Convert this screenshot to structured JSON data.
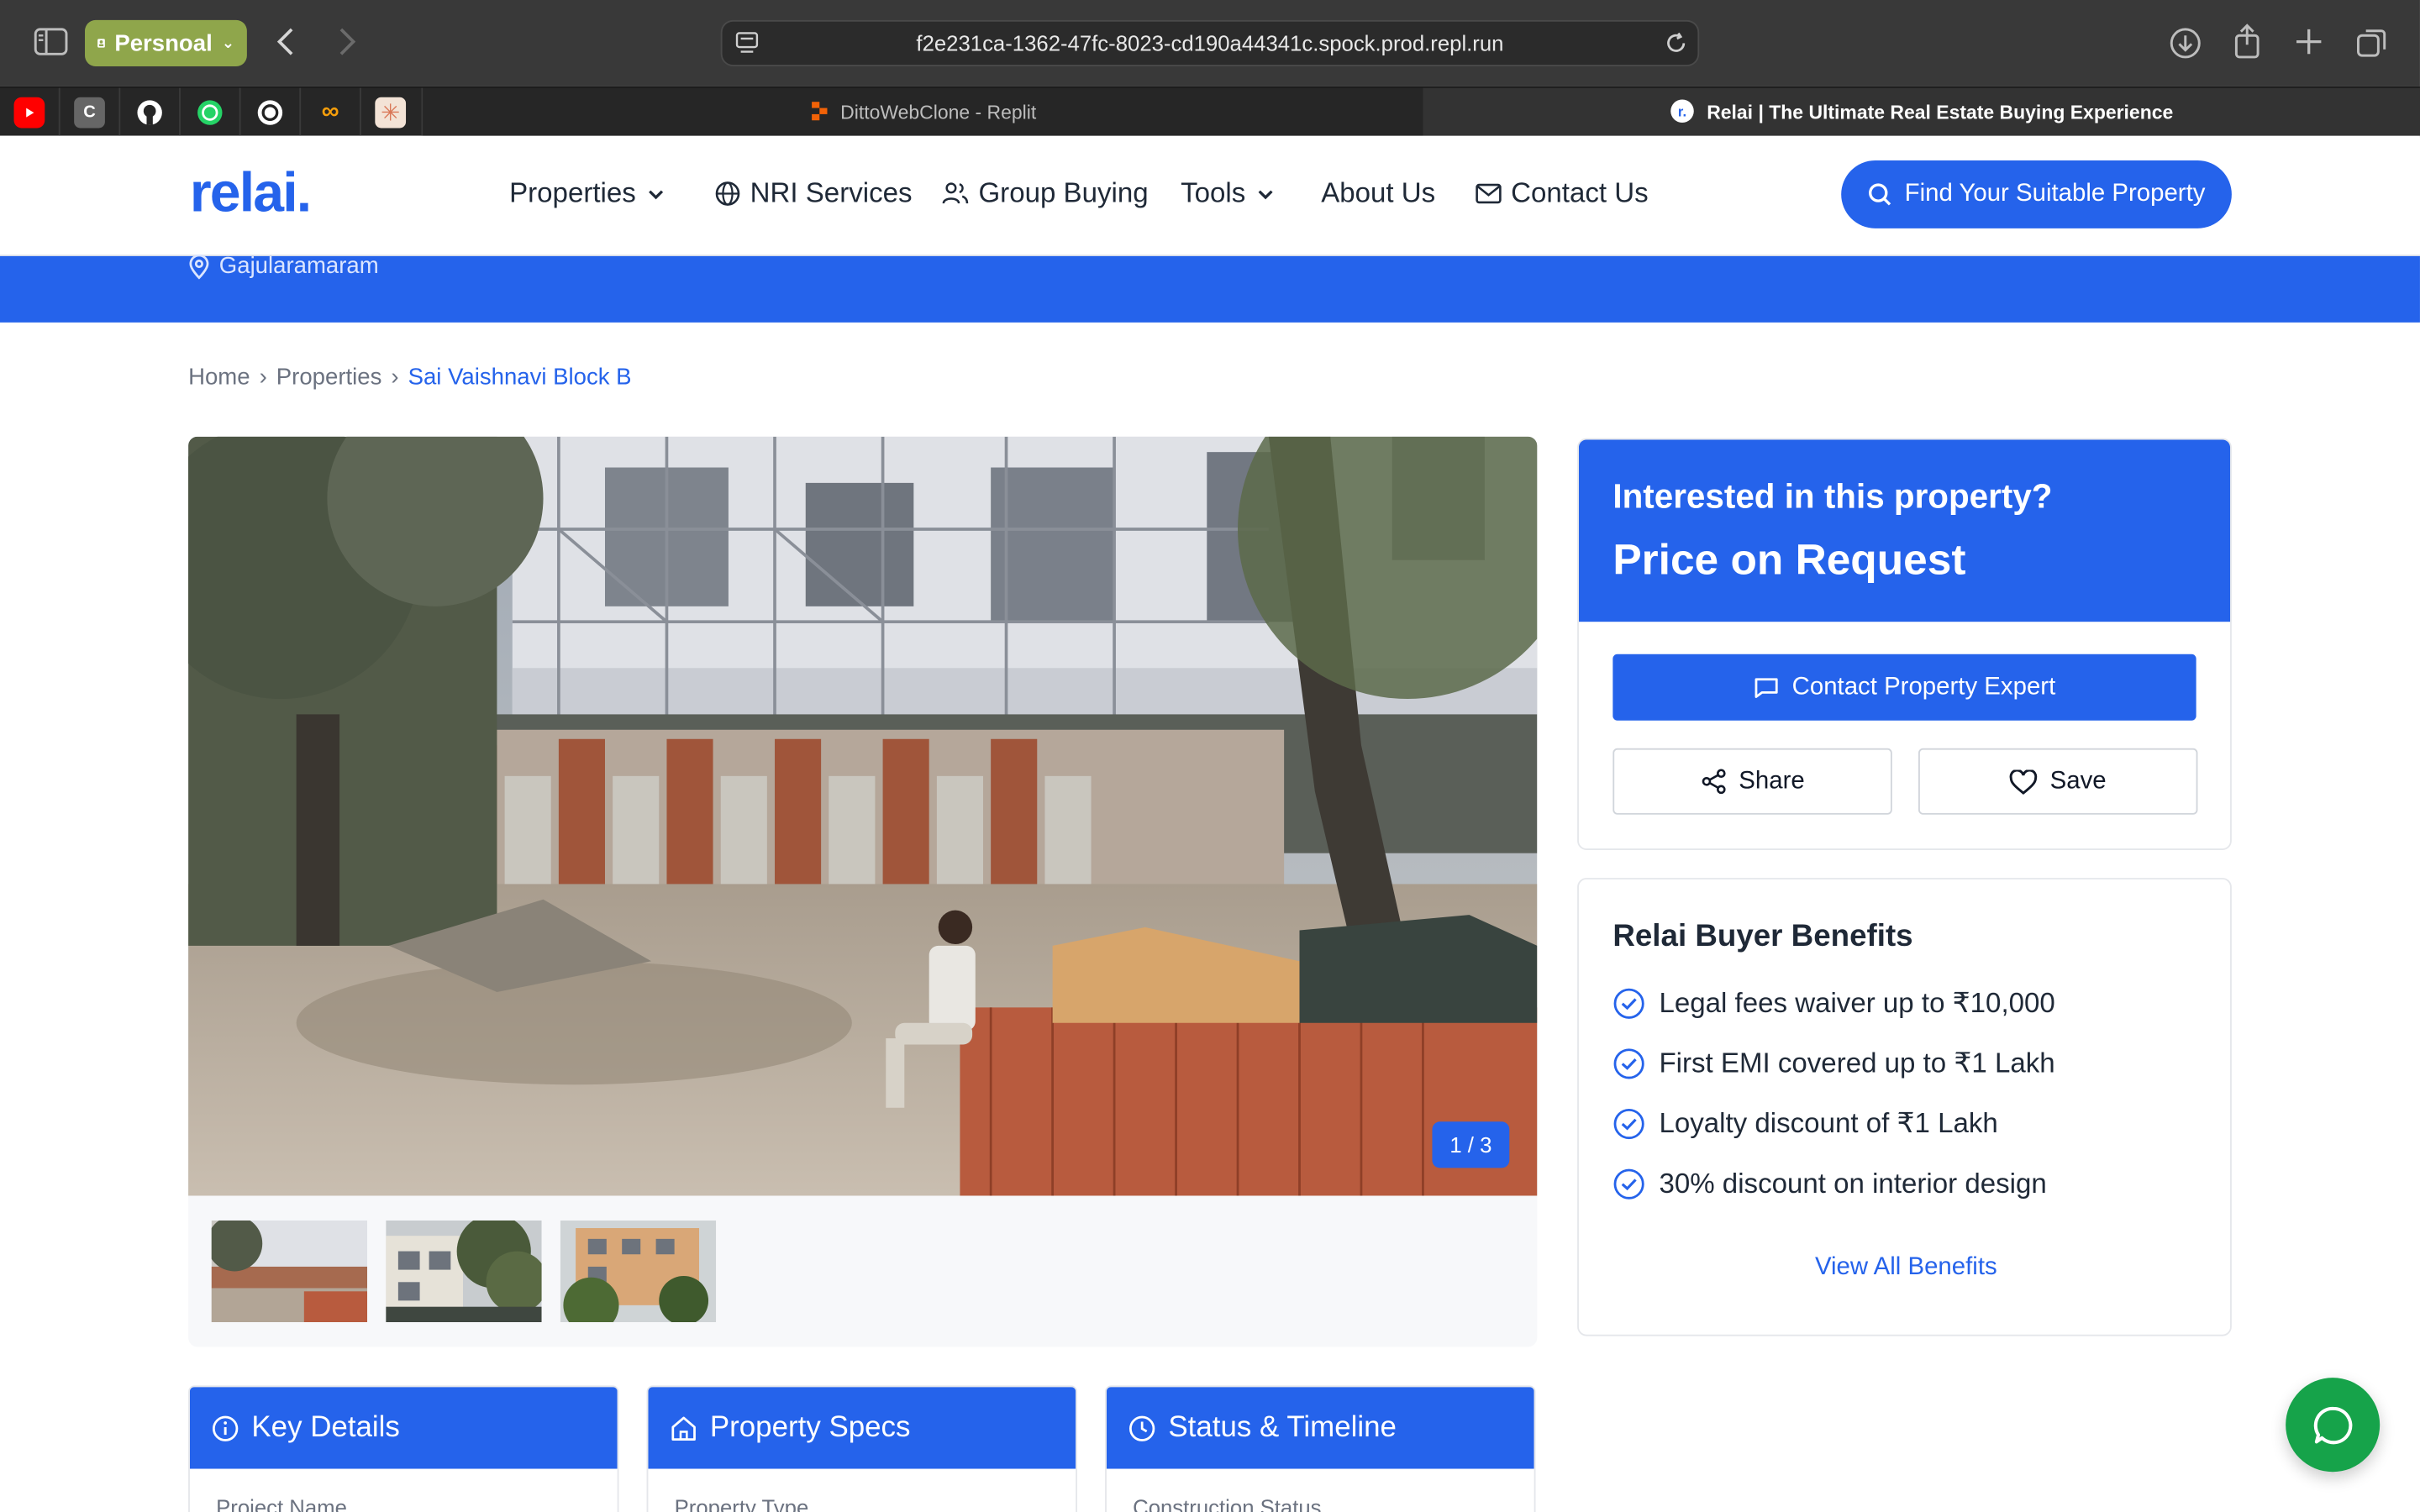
{
  "browser": {
    "profile_label": "Persnoal",
    "url": "f2e231ca-1362-47fc-8023-cd190a44341c.spock.prod.repl.run",
    "tabs": [
      {
        "title": "DittoWebClone - Replit",
        "active": false
      },
      {
        "title": "Relai | The Ultimate Real Estate Buying Experience",
        "active": true
      }
    ],
    "bookmarks": [
      "youtube-icon",
      "c-icon",
      "github-icon",
      "whatsapp-icon",
      "openai-icon",
      "infinity-icon",
      "claude-icon"
    ]
  },
  "site": {
    "logo": "relai.",
    "nav": {
      "properties": "Properties",
      "nri": "NRI Services",
      "group_buying": "Group Buying",
      "tools": "Tools",
      "about": "About Us",
      "contact": "Contact Us",
      "cta": "Find Your Suitable Property"
    },
    "location": "Gajularamaram",
    "breadcrumb": {
      "home": "Home",
      "properties": "Properties",
      "current": "Sai Vaishnavi Block B"
    },
    "gallery": {
      "counter": "1 / 3"
    },
    "interest": {
      "question": "Interested in this property?",
      "price": "Price on Request",
      "contact_button": "Contact Property Expert",
      "share_button": "Share",
      "save_button": "Save"
    },
    "benefits": {
      "title": "Relai Buyer Benefits",
      "items": [
        "Legal fees waiver up to ₹10,000",
        "First EMI covered up to ₹1 Lakh",
        "Loyalty discount of ₹1 Lakh",
        "30% discount on interior design"
      ],
      "view_all": "View All Benefits"
    },
    "info_cards": [
      {
        "title": "Key Details",
        "first_field": "Project Name"
      },
      {
        "title": "Property Specs",
        "first_field": "Property Type"
      },
      {
        "title": "Status & Timeline",
        "first_field": "Construction Status"
      }
    ]
  },
  "colors": {
    "brand": "#2563eb",
    "chat": "#16a34a",
    "profile": "#8fa64b"
  }
}
